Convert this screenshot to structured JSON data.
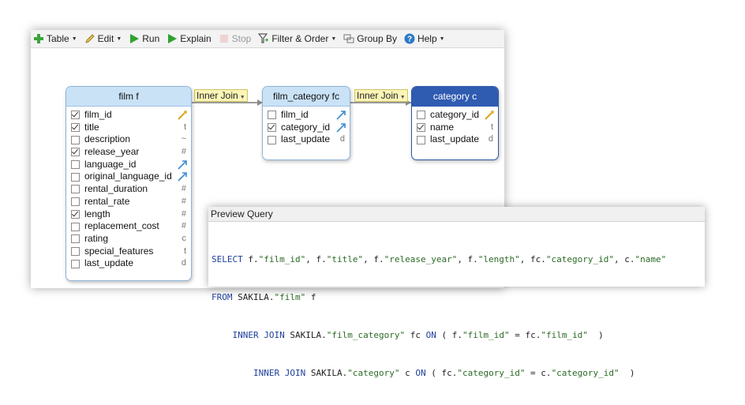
{
  "toolbar": {
    "table": "Table",
    "edit": "Edit",
    "run": "Run",
    "explain": "Explain",
    "stop": "Stop",
    "filter_order": "Filter & Order",
    "group_by": "Group By",
    "help": "Help"
  },
  "tables": [
    {
      "title": "film f",
      "fields": [
        {
          "name": "film_id",
          "type": "",
          "checked": true,
          "icon": "primary-key-icon"
        },
        {
          "name": "title",
          "type": "t",
          "checked": true
        },
        {
          "name": "description",
          "type": "~",
          "checked": false
        },
        {
          "name": "release_year",
          "type": "#",
          "checked": true
        },
        {
          "name": "language_id",
          "type": "",
          "checked": false,
          "icon": "foreign-key-icon"
        },
        {
          "name": "original_language_id",
          "type": "",
          "checked": false,
          "icon": "foreign-key-icon"
        },
        {
          "name": "rental_duration",
          "type": "#",
          "checked": false
        },
        {
          "name": "rental_rate",
          "type": "#",
          "checked": false
        },
        {
          "name": "length",
          "type": "#",
          "checked": true
        },
        {
          "name": "replacement_cost",
          "type": "#",
          "checked": false
        },
        {
          "name": "rating",
          "type": "c",
          "checked": false
        },
        {
          "name": "special_features",
          "type": "t",
          "checked": false
        },
        {
          "name": "last_update",
          "type": "d",
          "checked": false
        }
      ]
    },
    {
      "title": "film_category fc",
      "fields": [
        {
          "name": "film_id",
          "type": "",
          "checked": false,
          "icon": "foreign-key-icon"
        },
        {
          "name": "category_id",
          "type": "",
          "checked": true,
          "icon": "foreign-key-icon"
        },
        {
          "name": "last_update",
          "type": "d",
          "checked": false
        }
      ]
    },
    {
      "title": "category c",
      "fields": [
        {
          "name": "category_id",
          "type": "",
          "checked": false,
          "icon": "primary-key-icon"
        },
        {
          "name": "name",
          "type": "t",
          "checked": true
        },
        {
          "name": "last_update",
          "type": "d",
          "checked": false
        }
      ]
    }
  ],
  "joins": [
    {
      "label": "Inner Join"
    },
    {
      "label": "Inner Join"
    }
  ],
  "preview": {
    "title": "Preview Query",
    "lines": [
      "SELECT f.\"film_id\", f.\"title\", f.\"release_year\", f.\"length\", fc.\"category_id\", c.\"name\"",
      "FROM SAKILA.\"film\" f",
      "    INNER JOIN SAKILA.\"film_category\" fc ON ( f.\"film_id\" = fc.\"film_id\"  )",
      "        INNER JOIN SAKILA.\"category\" c ON ( fc.\"category_id\" = c.\"category_id\"  )"
    ]
  }
}
